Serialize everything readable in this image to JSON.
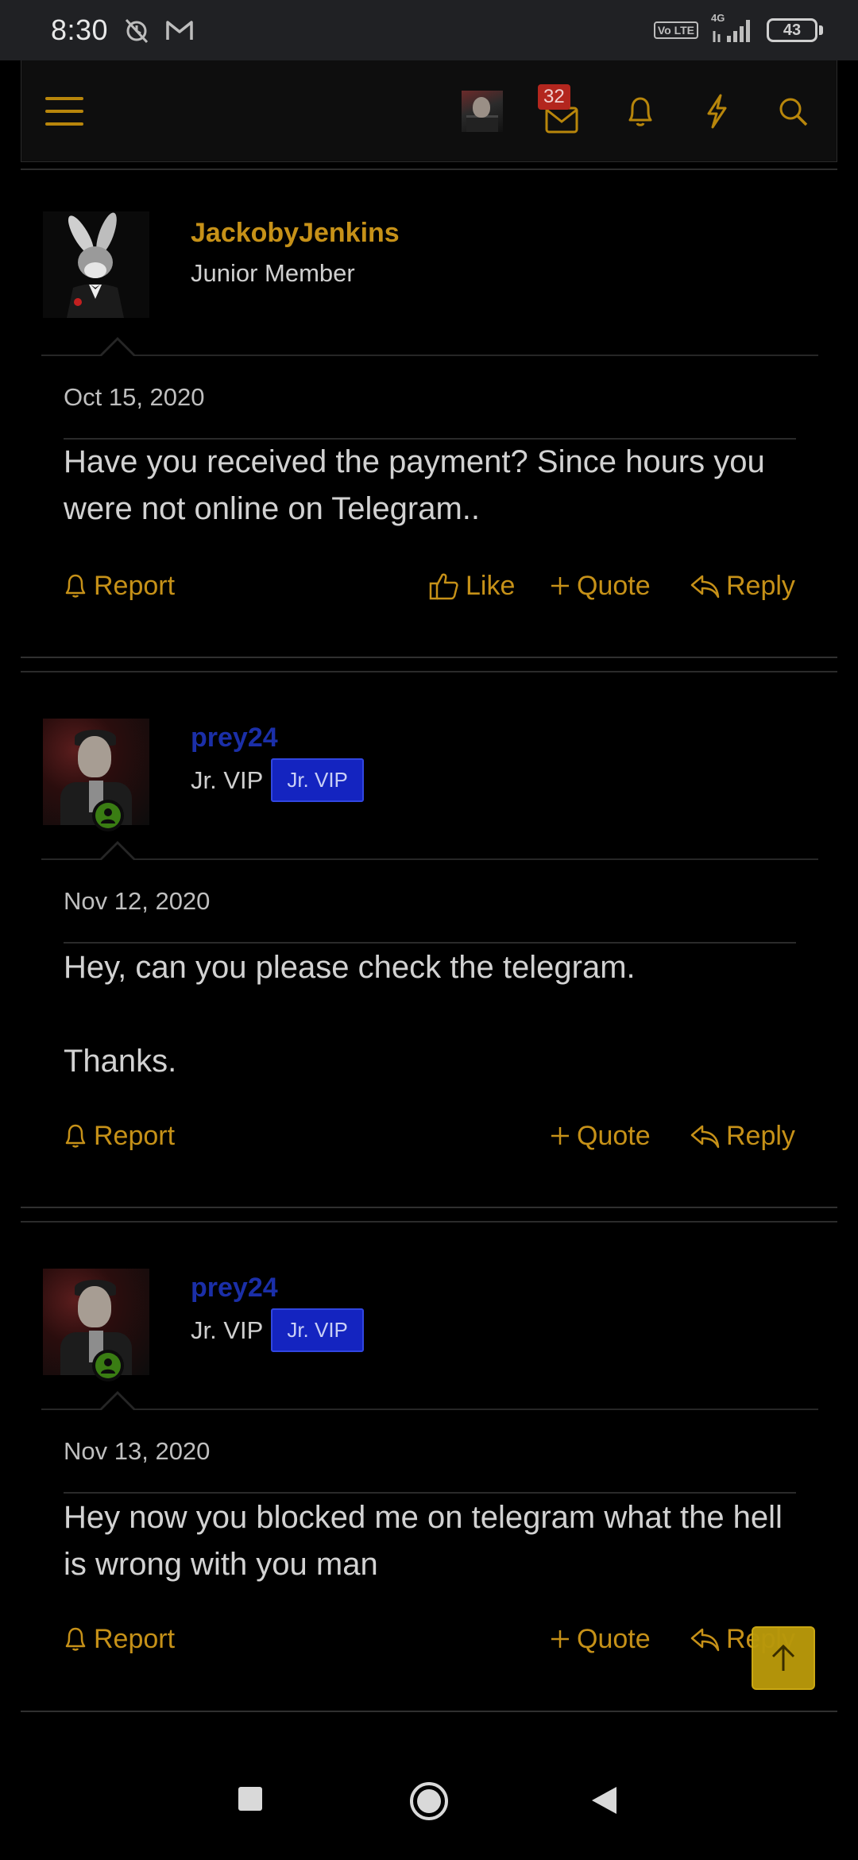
{
  "status_bar": {
    "time": "8:30",
    "network": "4G",
    "volte": "Vo LTE",
    "battery": "43"
  },
  "header": {
    "inbox_count": "32"
  },
  "posts": [
    {
      "username": "JackobyJenkins",
      "user_title": "Junior Member",
      "date": "Oct 15, 2020",
      "message": "Have you received the payment? Since hours you were not online on Telegram..",
      "actions": {
        "report": "Report",
        "like": "Like",
        "quote": "Quote",
        "reply": "Reply"
      }
    },
    {
      "username": "prey24",
      "user_title": "Jr. VIP",
      "badge": "Jr. VIP",
      "date": "Nov 12, 2020",
      "message": "Hey, can you please check the telegram.\n\nThanks.",
      "actions": {
        "report": "Report",
        "quote": "Quote",
        "reply": "Reply"
      }
    },
    {
      "username": "prey24",
      "user_title": "Jr. VIP",
      "badge": "Jr. VIP",
      "date": "Nov 13, 2020",
      "message": "Hey now you blocked me on telegram what the hell is wrong with you man",
      "actions": {
        "report": "Report",
        "quote": "Quote",
        "reply": "Reply"
      }
    }
  ],
  "colors": {
    "accent": "#c69118",
    "username_blue": "#1b2fa8",
    "vip_badge": "#1424c0",
    "background": "#000000"
  }
}
